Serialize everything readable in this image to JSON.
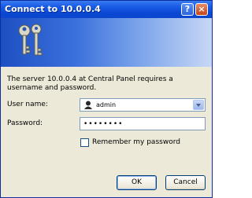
{
  "window": {
    "title": "Connect to 10.0.0.4",
    "help_glyph": "?",
    "close_glyph": "×"
  },
  "dialog": {
    "message": "The server 10.0.0.4 at Central Panel requires a username and password.",
    "username_label": "User name:",
    "username_value": "admin",
    "password_label": "Password:",
    "password_value": "••••••••",
    "remember_label": "Remember my password",
    "remember_checked": false,
    "ok_label": "OK",
    "cancel_label": "Cancel"
  },
  "icons": {
    "banner": "keys-icon",
    "user": "user-icon",
    "dropdown": "chevron-down-icon"
  },
  "colors": {
    "title_bar": "#0a48d4",
    "dialog_bg": "#ece9d8",
    "banner_left": "#1e4fc2",
    "banner_right": "#c8d8f6",
    "field_border": "#7f9db9"
  }
}
